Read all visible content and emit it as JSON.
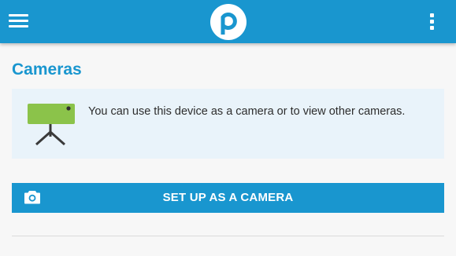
{
  "appbar": {
    "menu_icon": "hamburger-menu-icon",
    "logo_letter": "p",
    "overflow_icon": "more-vert-icon",
    "brand_color": "#1996cf"
  },
  "main": {
    "title": "Cameras",
    "info_card": {
      "illustration_icon": "camera-tripod-icon",
      "text": "You can use this device as a camera or to view other cameras."
    },
    "setup_button": {
      "icon": "camera-icon",
      "label": "SET UP AS A CAMERA"
    }
  }
}
